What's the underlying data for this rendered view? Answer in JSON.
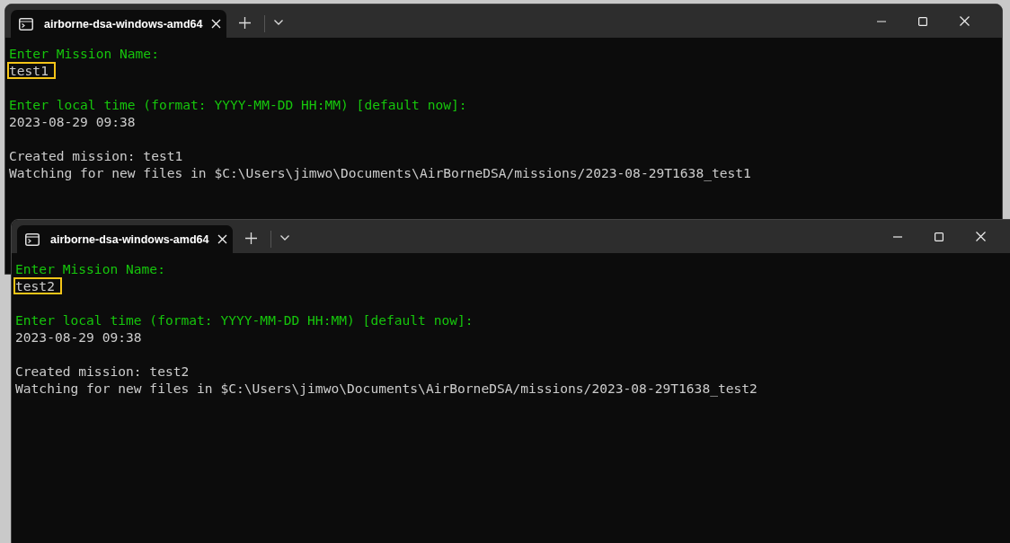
{
  "windows": [
    {
      "tab": {
        "title": "airborne-dsa-windows-amd64",
        "selected": true
      },
      "blocks": [
        [
          {
            "kind": "prompt",
            "text": "Enter Mission Name:"
          },
          {
            "kind": "input",
            "text": "test1",
            "highlighted": true
          }
        ],
        [
          {
            "kind": "prompt",
            "text": "Enter local time (format: YYYY-MM-DD HH:MM) [default now]:"
          },
          {
            "kind": "input",
            "text": "2023-08-29 09:38",
            "highlighted": false
          }
        ],
        [
          {
            "kind": "output",
            "text": "Created mission: test1"
          },
          {
            "kind": "output",
            "text": "Watching for new files in $C:\\Users\\jimwo\\Documents\\AirBorneDSA/missions/2023-08-29T1638_test1"
          }
        ]
      ]
    },
    {
      "tab": {
        "title": "airborne-dsa-windows-amd64",
        "selected": true
      },
      "blocks": [
        [
          {
            "kind": "prompt",
            "text": "Enter Mission Name:"
          },
          {
            "kind": "input",
            "text": "test2",
            "highlighted": true
          }
        ],
        [
          {
            "kind": "prompt",
            "text": "Enter local time (format: YYYY-MM-DD HH:MM) [default now]:"
          },
          {
            "kind": "input",
            "text": "2023-08-29 09:38",
            "highlighted": false
          }
        ],
        [
          {
            "kind": "output",
            "text": "Created mission: test2"
          },
          {
            "kind": "output",
            "text": "Watching for new files in $C:\\Users\\jimwo\\Documents\\AirBorneDSA/missions/2023-08-29T1638_test2"
          }
        ]
      ]
    }
  ]
}
